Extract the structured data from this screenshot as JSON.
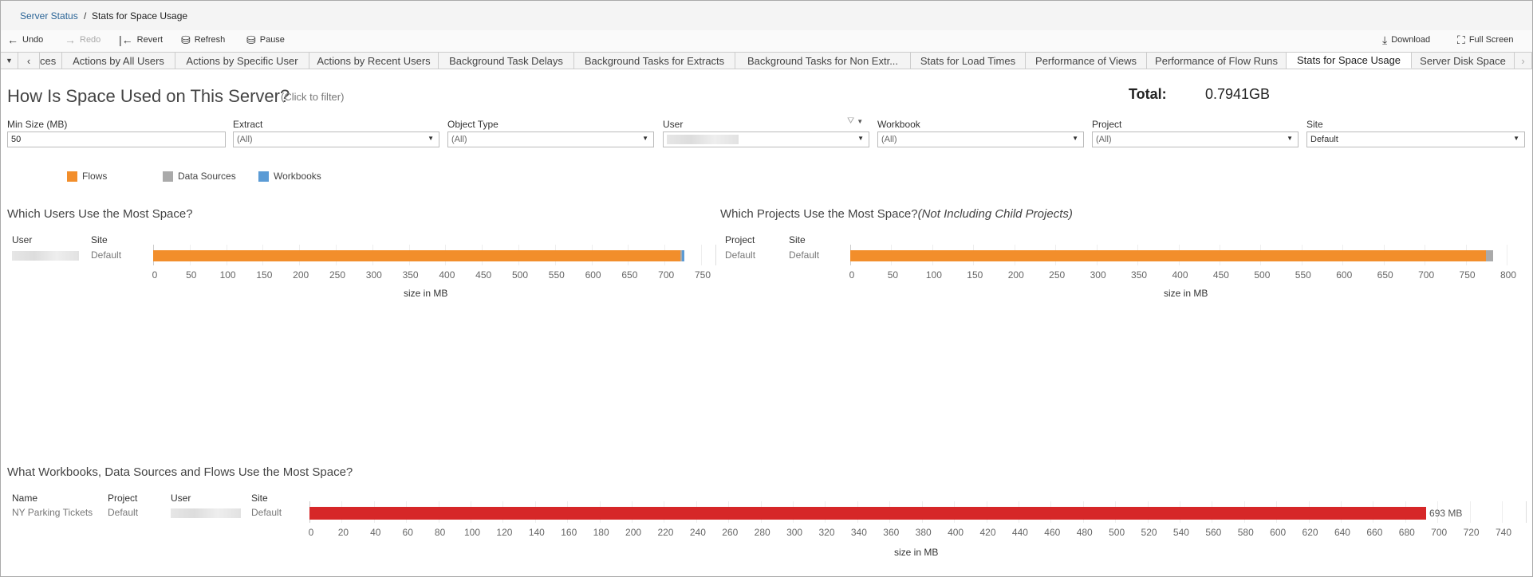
{
  "breadcrumb": {
    "parent": "Server Status",
    "separator": "/",
    "current": "Stats for Space Usage"
  },
  "toolbar": {
    "undo": "Undo",
    "redo": "Redo",
    "revert": "Revert",
    "refresh": "Refresh",
    "pause": "Pause",
    "download": "Download",
    "full_screen": "Full Screen"
  },
  "tabs": [
    "ces",
    "Actions by All Users",
    "Actions by Specific User",
    "Actions by Recent Users",
    "Background Task Delays",
    "Background Tasks for Extracts",
    "Background Tasks for Non Extr...",
    "Stats for Load Times",
    "Performance of Views",
    "Performance of Flow Runs",
    "Stats for Space Usage",
    "Server Disk Space"
  ],
  "active_tab": "Stats for Space Usage",
  "header": {
    "title": "How Is Space Used on This Server?",
    "hint": "(Click to filter)",
    "total_label": "Total:",
    "total_value": "0.7941GB"
  },
  "filters": [
    {
      "label": "Min Size (MB)",
      "value": "50"
    },
    {
      "label": "Extract",
      "value": "(All)"
    },
    {
      "label": "Object Type",
      "value": "(All)"
    },
    {
      "label": "User",
      "value": ""
    },
    {
      "label": "Workbook",
      "value": "(All)"
    },
    {
      "label": "Project",
      "value": "(All)"
    },
    {
      "label": "Site",
      "value": "Default"
    }
  ],
  "legend": [
    {
      "label": "Flows",
      "color": "#f28e2b"
    },
    {
      "label": "Data Sources",
      "color": "#aaaaaa"
    },
    {
      "label": "Workbooks",
      "color": "#5b9bd5"
    }
  ],
  "chart_data": [
    {
      "type": "bar",
      "title": "Which Users Use the Most Space?",
      "columns": [
        "User",
        "Site"
      ],
      "rows": [
        [
          "",
          "Default"
        ]
      ],
      "series": [
        {
          "name": "Flows",
          "values": [
            722
          ]
        },
        {
          "name": "Data Sources",
          "values": [
            2
          ]
        },
        {
          "name": "Workbooks",
          "values": [
            3
          ]
        }
      ],
      "xlabel": "size in MB",
      "xlim": [
        0,
        750
      ],
      "ticks": [
        0,
        50,
        100,
        150,
        200,
        250,
        300,
        350,
        400,
        450,
        500,
        550,
        600,
        650,
        700,
        750
      ]
    },
    {
      "type": "bar",
      "title": "Which Projects Use the Most Space?",
      "subtitle": "(Not Including Child Projects)",
      "columns": [
        "Project",
        "Site"
      ],
      "rows": [
        [
          "Default",
          "Default"
        ]
      ],
      "series": [
        {
          "name": "Flows",
          "values": [
            775
          ]
        },
        {
          "name": "Data Sources",
          "values": [
            8
          ]
        }
      ],
      "xlabel": "size in MB",
      "xlim": [
        0,
        800
      ],
      "ticks": [
        0,
        50,
        100,
        150,
        200,
        250,
        300,
        350,
        400,
        450,
        500,
        550,
        600,
        650,
        700,
        750,
        800
      ]
    },
    {
      "type": "bar",
      "title": "What Workbooks, Data Sources and Flows Use the Most Space?",
      "columns": [
        "Name",
        "Project",
        "User",
        "Site"
      ],
      "rows": [
        [
          "NY Parking Tickets",
          "Default",
          "",
          "Default"
        ]
      ],
      "values": [
        693
      ],
      "data_labels": [
        "693 MB"
      ],
      "color": "#d62728",
      "xlabel": "size in MB",
      "xlim": [
        0,
        740
      ],
      "ticks": [
        0,
        20,
        40,
        60,
        80,
        100,
        120,
        140,
        160,
        180,
        200,
        220,
        240,
        260,
        280,
        300,
        320,
        340,
        360,
        380,
        400,
        420,
        440,
        460,
        480,
        500,
        520,
        540,
        560,
        580,
        600,
        620,
        640,
        660,
        680,
        700,
        720,
        740
      ]
    }
  ]
}
